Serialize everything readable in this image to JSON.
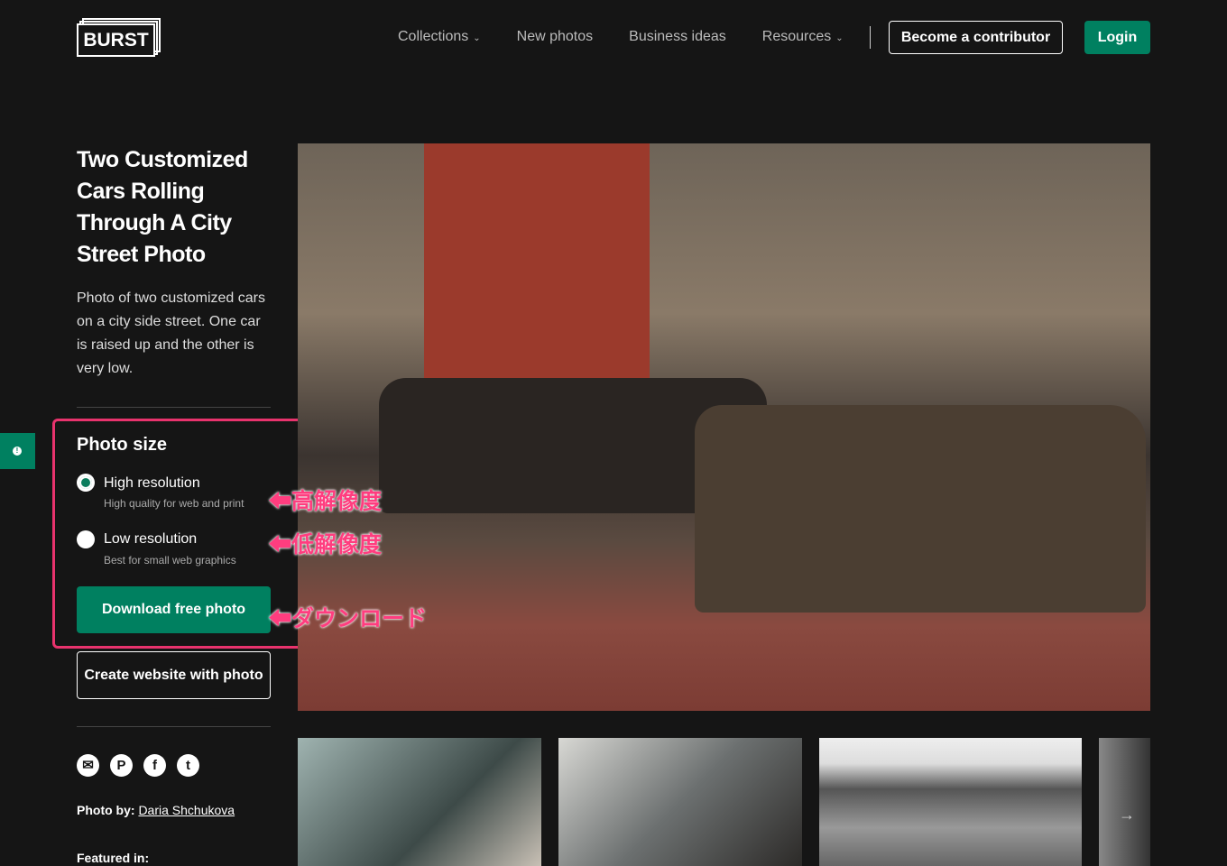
{
  "nav": {
    "logo": "BURST",
    "links": [
      {
        "label": "Collections",
        "dropdown": true
      },
      {
        "label": "New photos"
      },
      {
        "label": "Business ideas"
      },
      {
        "label": "Resources",
        "dropdown": true
      }
    ],
    "contributor": "Become a contributor",
    "login": "Login"
  },
  "photo": {
    "title": "Two Customized Cars Rolling Through A City Street Photo",
    "description": "Photo of two customized cars on a city side street. One car is raised up and the other is very low."
  },
  "size": {
    "title": "Photo size",
    "options": [
      {
        "label": "High resolution",
        "sub": "High quality for web and print",
        "selected": true
      },
      {
        "label": "Low resolution",
        "sub": "Best for small web graphics",
        "selected": false
      }
    ]
  },
  "buttons": {
    "download": "Download free photo",
    "website": "Create website with photo"
  },
  "annotations": {
    "high": "⬅高解像度",
    "low": "⬅低解像度",
    "download": "⬅ダウンロード"
  },
  "social": [
    "mail-icon",
    "pinterest-icon",
    "facebook-icon",
    "twitter-icon"
  ],
  "credit": {
    "label": "Photo by:",
    "author": "Daria Shchukova"
  },
  "featured": "Featured in:",
  "colors": {
    "accent": "#008060",
    "annotation": "#e8336d",
    "background": "#151515"
  }
}
